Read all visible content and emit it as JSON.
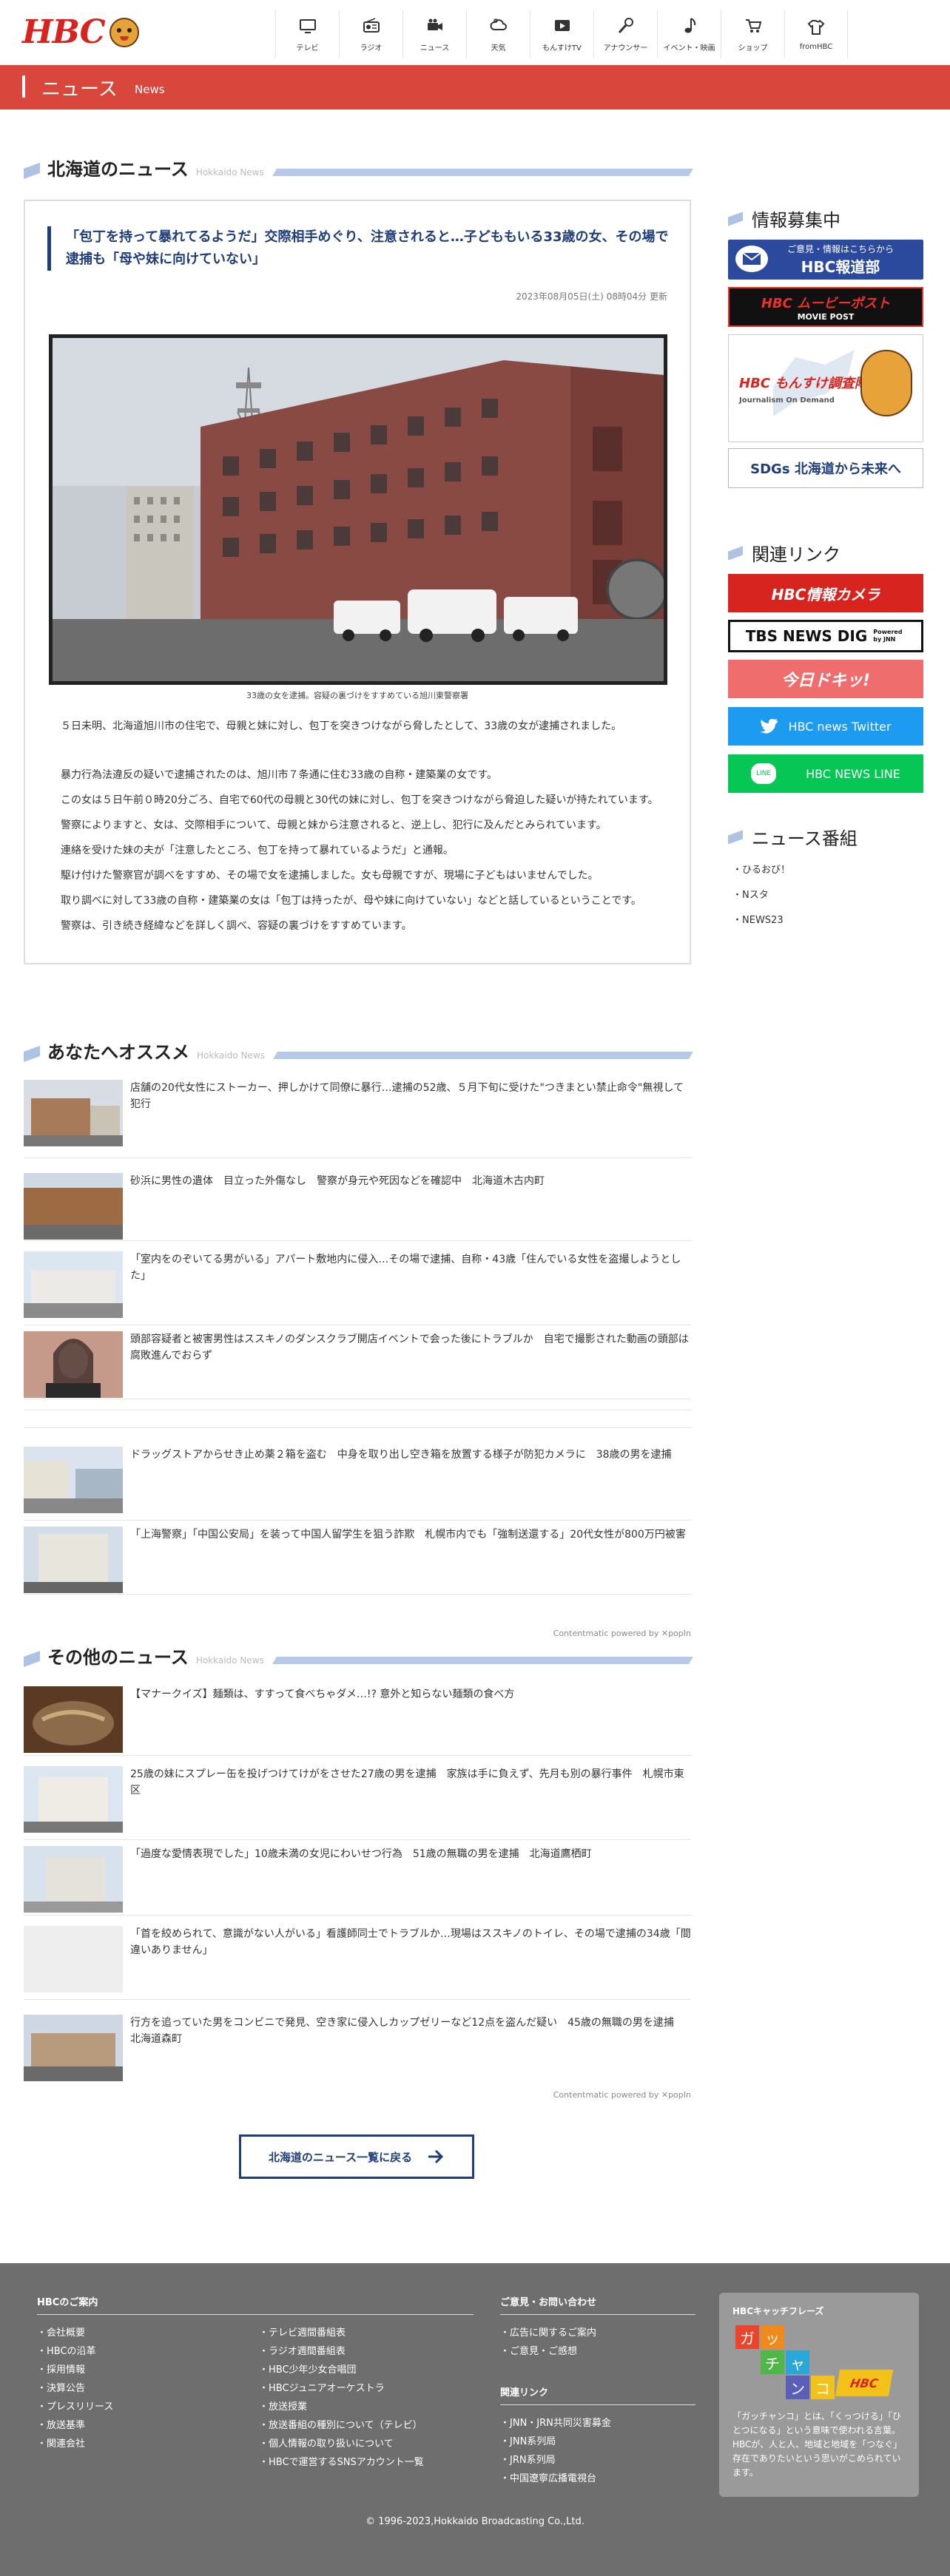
{
  "header": {
    "logo": "HBC",
    "nav": [
      {
        "label": "テレビ",
        "icon": "tv-icon"
      },
      {
        "label": "ラジオ",
        "icon": "radio-icon"
      },
      {
        "label": "ニュース",
        "icon": "camera-icon"
      },
      {
        "label": "天気",
        "icon": "weather-icon"
      },
      {
        "label": "もんすけTV",
        "icon": "play-icon"
      },
      {
        "label": "アナウンサー",
        "icon": "microphone-icon"
      },
      {
        "label": "イベント・映画",
        "icon": "music-icon"
      },
      {
        "label": "ショップ",
        "icon": "cart-icon"
      },
      {
        "label": "fromHBC",
        "icon": "shirt-icon"
      }
    ]
  },
  "page_title": {
    "main": "ニュース",
    "sub": "News"
  },
  "section_hokkaido": {
    "title": "北海道のニュース",
    "sub": "Hokkaido News"
  },
  "article": {
    "title": "「包丁を持って暴れてるようだ」交際相手めぐり、注意されると…子どももいる33歳の女、その場で逮捕も「母や妹に向けていない」",
    "date": "2023年08月05日(土) 08時04分 更新",
    "caption": "33歳の女を逮捕。容疑の裏づけをすすめている旭川東警察署",
    "paragraphs": [
      "５日未明、北海道旭川市の住宅で、母親と妹に対し、包丁を突きつけながら脅したとして、33歳の女が逮捕されました。",
      "暴力行為法違反の疑いで逮捕されたのは、旭川市７条通に住む33歳の自称・建築業の女です。",
      "この女は５日午前０時20分ごろ、自宅で60代の母親と30代の妹に対し、包丁を突きつけながら脅迫した疑いが持たれています。",
      "警察によりますと、女は、交際相手について、母親と妹から注意されると、逆上し、犯行に及んだとみられています。",
      "連絡を受けた妹の夫が「注意したところ、包丁を持って暴れているようだ」と通報。",
      "駆け付けた警察官が調べをすすめ、その場で女を逮捕しました。女も母親ですが、現場に子どもはいませんでした。",
      "取り調べに対して33歳の自称・建築業の女は「包丁は持ったが、母や妹に向けていない」などと話しているということです。",
      "警察は、引き続き経緯などを詳しく調べ、容疑の裏づけをすすめています。"
    ]
  },
  "sidebar": {
    "recruit_title": "情報募集中",
    "banners": [
      {
        "top": "ご意見・情報はこちらから",
        "main": "HBC報道部"
      },
      {
        "main": "HBC ムービーポスト",
        "sub": "MOVIE POST"
      },
      {
        "main": "HBC もんすけ調査隊",
        "sub": "Journalism On Demand"
      },
      {
        "main": "SDGs 北海道から未来へ"
      }
    ],
    "links_title": "関連リンク",
    "links": [
      {
        "label": "HBC情報カメラ"
      },
      {
        "label": "TBS NEWS DIG",
        "sub": "Powered by JNN"
      },
      {
        "label": "今日ドキッ!"
      },
      {
        "label": "HBC news Twitter"
      },
      {
        "label": "HBC NEWS LINE"
      }
    ],
    "programs_title": "ニュース番組",
    "programs": [
      "ひるおび！",
      "Nスタ",
      "NEWS23"
    ]
  },
  "section_recommend": {
    "title": "あなたへオススメ",
    "sub": "Hokkaido News"
  },
  "recommend": [
    "店舗の20代女性にストーカー、押しかけて同僚に暴行…逮捕の52歳、５月下旬に受けた\"つきまとい禁止命令\"無視して犯行",
    "砂浜に男性の遺体　目立った外傷なし　警察が身元や死因などを確認中　北海道木古内町",
    "「室内をのぞいてる男がいる」アパート敷地内に侵入…その場で逮捕、自称・43歳「住んでいる女性を盗撮しようとした」",
    "頭部容疑者と被害男性はススキノのダンスクラブ開店イベントで会った後にトラブルか　自宅で撮影された動画の頭部は腐敗進んでおらず",
    "ドラッグストアからせき止め薬２箱を盗む　中身を取り出し空き箱を放置する様子が防犯カメラに　38歳の男を逮捕",
    "「上海警察」「中国公安局」を装って中国人留学生を狙う詐欺　札幌市内でも「強制送還する」20代女性が800万円被害"
  ],
  "powered": "Contentmatic powered by ✕popIn",
  "section_other": {
    "title": "その他のニュース",
    "sub": "Hokkaido News"
  },
  "other": [
    "【マナークイズ】麺類は、すすって食べちゃダメ…!? 意外と知らない麺類の食べ方",
    "25歳の妹にスプレー缶を投げつけてけがをさせた27歳の男を逮捕　家族は手に負えず、先月も別の暴行事件　札幌市東区",
    "「過度な愛情表現でした」10歳未満の女児にわいせつ行為　51歳の無職の男を逮捕　北海道鷹栖町",
    "「首を絞められて、意識がない人がいる」看護師同士でトラブルか…現場はススキノのトイレ、その場で逮捕の34歳「間違いありません」",
    "行方を追っていた男をコンビニで発見、空き家に侵入しカップゼリーなど12点を盗んだ疑い　45歳の無職の男を逮捕　北海道森町"
  ],
  "more_button": "北海道のニュース一覧に戻る",
  "footer": {
    "about_title": "HBCのご案内",
    "about_col1": [
      "会社概要",
      "HBCの沿革",
      "採用情報",
      "決算公告",
      "プレスリリース",
      "放送基準",
      "関連会社"
    ],
    "about_col2": [
      "テレビ週間番組表",
      "ラジオ週間番組表",
      "HBC少年少女合唱団",
      "HBCジュニアオーケストラ",
      "放送授業",
      "放送番組の種別について（テレビ）",
      "個人情報の取り扱いについて",
      "HBCで運営するSNSアカウント一覧"
    ],
    "contact_title": "ご意見・お問い合わせ",
    "contact": [
      "広告に関するご案内",
      "ご意見・ご感想"
    ],
    "related_title": "関連リンク",
    "related": [
      "JNN・JRN共同災害募金",
      "JNN系列局",
      "JRN系列局",
      "中国遼寧広播電視台"
    ],
    "catch_title": "HBCキャッチフレーズ",
    "catch_chars": [
      "ガ",
      "ッ",
      "チ",
      "ャ",
      "ン",
      "コ"
    ],
    "catch_logo": "HBC",
    "catch_text": "「ガッチャンコ」とは、「くっつける」「ひとつになる」という意味で使われる言葉。HBCが、人と人、地域と地域を「つなぐ」存在でありたいという思いがこめられています。",
    "copyright": "© 1996-2023,Hokkaido Broadcasting Co.,Ltd."
  }
}
